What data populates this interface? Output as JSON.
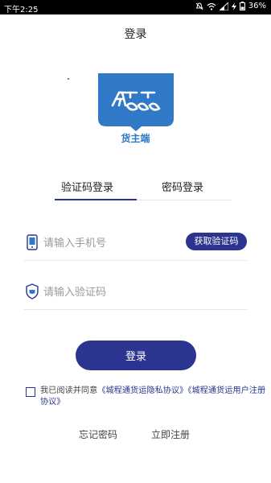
{
  "status_bar": {
    "time": "下午2:25",
    "battery": "36%",
    "icons": [
      "mute-icon",
      "wifi-icon",
      "signal-icon",
      "charging-icon",
      "battery-icon"
    ]
  },
  "page": {
    "title": "登录"
  },
  "logo": {
    "text": "货主端",
    "color": "#2f79c7"
  },
  "tabs": [
    {
      "label": "验证码登录",
      "active": true
    },
    {
      "label": "密码登录",
      "active": false
    }
  ],
  "phone_field": {
    "placeholder": "请输入手机号",
    "value": ""
  },
  "get_code_button": {
    "label": "获取验证码"
  },
  "code_field": {
    "placeholder": "请输入验证码",
    "value": ""
  },
  "login_button": {
    "label": "登录"
  },
  "agreement": {
    "prefix": "我已阅读并同意",
    "privacy_link": "《城程通货运隐私协议》",
    "user_link": "《城程通货运用户注册协议》",
    "checked": false
  },
  "links": {
    "forgot": "忘记密码",
    "register": "立即注册"
  },
  "colors": {
    "accent": "#2b3590",
    "logo": "#2f79c7"
  }
}
